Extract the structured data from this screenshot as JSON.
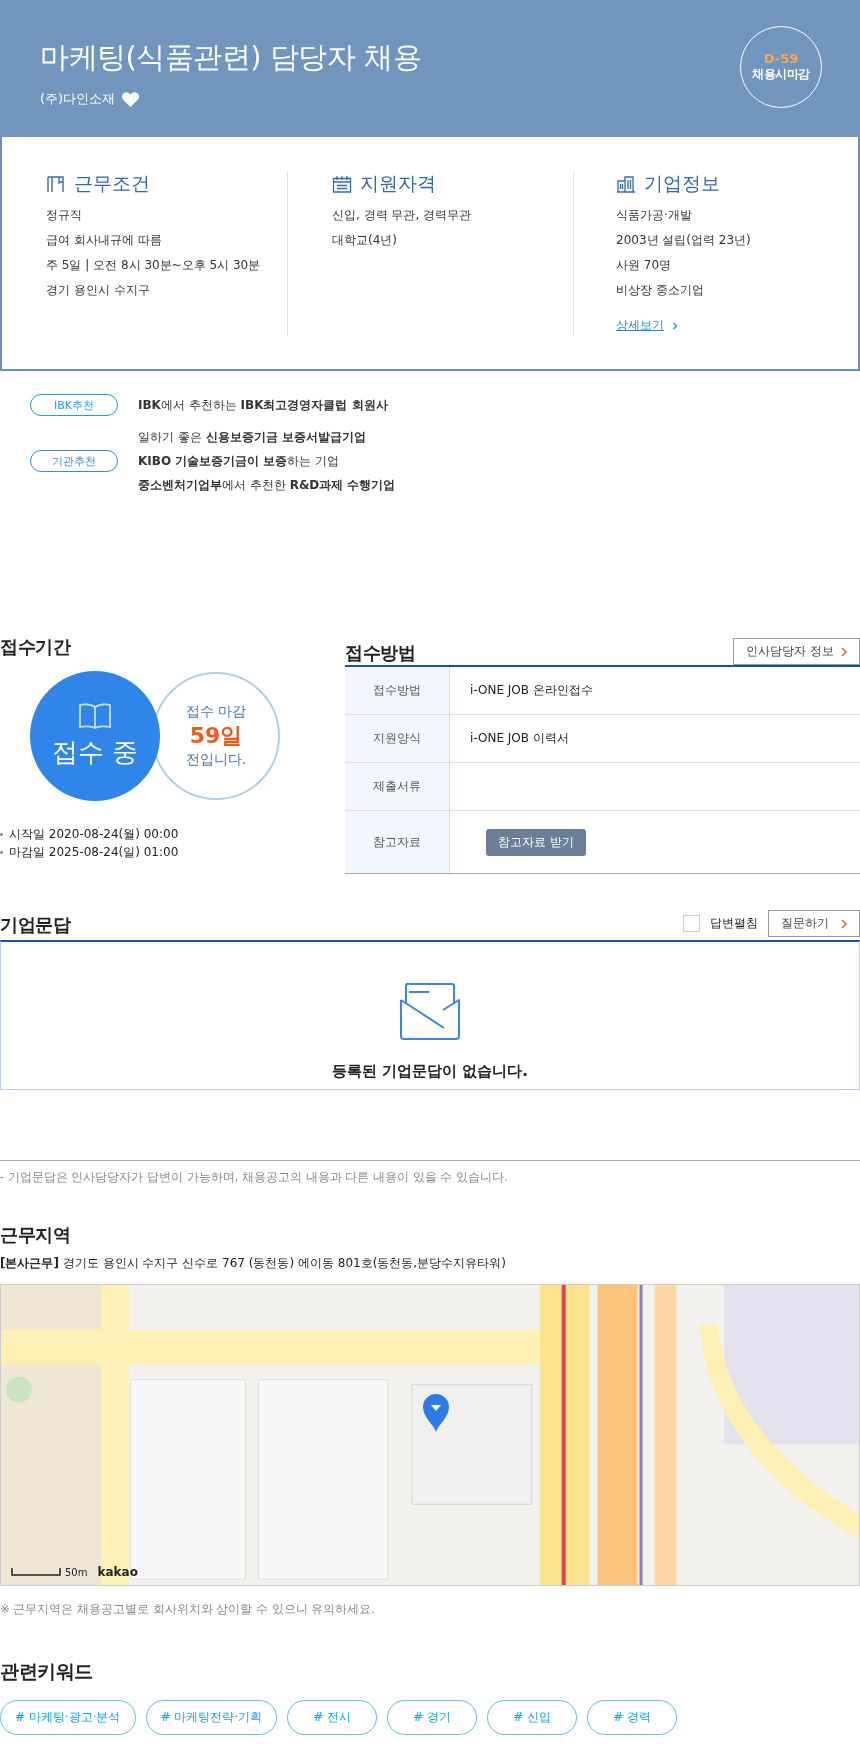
{
  "header": {
    "title": "마케팅(식품관련) 담당자 채용",
    "company": "(주)다인소재",
    "deadline_badge": {
      "dday": "D-59",
      "label": "채용시마감"
    }
  },
  "summary": [
    {
      "kind": "conditions",
      "title": "근무조건",
      "lines": [
        "정규직",
        "급여 회사내규에 따름",
        "주 5일 | 오전 8시 30분~오후 5시 30분",
        "경기 용인시 수지구"
      ]
    },
    {
      "kind": "qualifications",
      "title": "지원자격",
      "lines": [
        "신입, 경력 무관, 경력무관",
        "대학교(4년)"
      ]
    },
    {
      "kind": "company",
      "title": "기업정보",
      "lines": [
        "식품가공·개발",
        "2003년 설립(업력 23년)",
        "사원 70명",
        "비상장 중소기업"
      ],
      "link": "상세보기"
    }
  ],
  "recommendations": [
    {
      "badge": "IBK추천",
      "color": "#1aa0e2",
      "lines": [
        "**IBK**에서 추천하는 **IBK최고경영자클럽 회원사**"
      ]
    },
    {
      "badge": "기관추천",
      "color": "#3a8ae0",
      "lines": [
        "일하기 좋은 **신용보증기금 보증서발급기업**",
        "**KIBO 기술보증기금이 보증**하는 기업",
        "**중소벤처기업부**에서 추천한 **R&D과제 수행기업**"
      ]
    }
  ],
  "reception_period": {
    "title": "접수기간",
    "status": "접수 중",
    "deadline_lines": [
      "접수 마감",
      "59일",
      "전입니다."
    ],
    "dates": [
      "시작일 2020-08-24(월) 00:00",
      "마감일 2025-08-24(일) 01:00"
    ]
  },
  "application_method": {
    "title": "접수방법",
    "contact_button": "인사담당자 정보",
    "rows": [
      {
        "kind": "text",
        "label": "접수방법",
        "value": "i-ONE JOB 온라인접수"
      },
      {
        "kind": "text",
        "label": "지원양식",
        "value": "i-ONE JOB 이력서"
      },
      {
        "kind": "text",
        "label": "제출서류"
      },
      {
        "kind": "button",
        "label": "참고자료",
        "value": "참고자료 받기"
      }
    ]
  },
  "qna": {
    "title": "기업문답",
    "expand_label": "답변펼침",
    "expand_checked": false,
    "ask_button": "질문하기",
    "empty_message": "등록된 기업문답이 없습니다.",
    "note": "- 기업문답은 인사담당자가 답변이 가능하며, 채용공고의 내용과 다른 내용이 있을 수 있습니다."
  },
  "location": {
    "title": "근무지역",
    "tag": "[본사근무]",
    "address": "경기도 용인시 수지구 신수로 767 (동천동) 에이동 801호(동천동,분당수지유타워)",
    "map": {
      "kind": "picture",
      "scale": "50m",
      "provider": "kakao"
    },
    "note": "※ 근무지역은 채용공고별로 회사위치와 상이할 수 있으니 유의하세요."
  },
  "keywords": {
    "title": "관련키워드",
    "items": [
      "# 마케팅·광고·분석",
      "# 마케팅전략·기획",
      "# 전시",
      "# 경기",
      "# 신입",
      "# 경력"
    ]
  }
}
